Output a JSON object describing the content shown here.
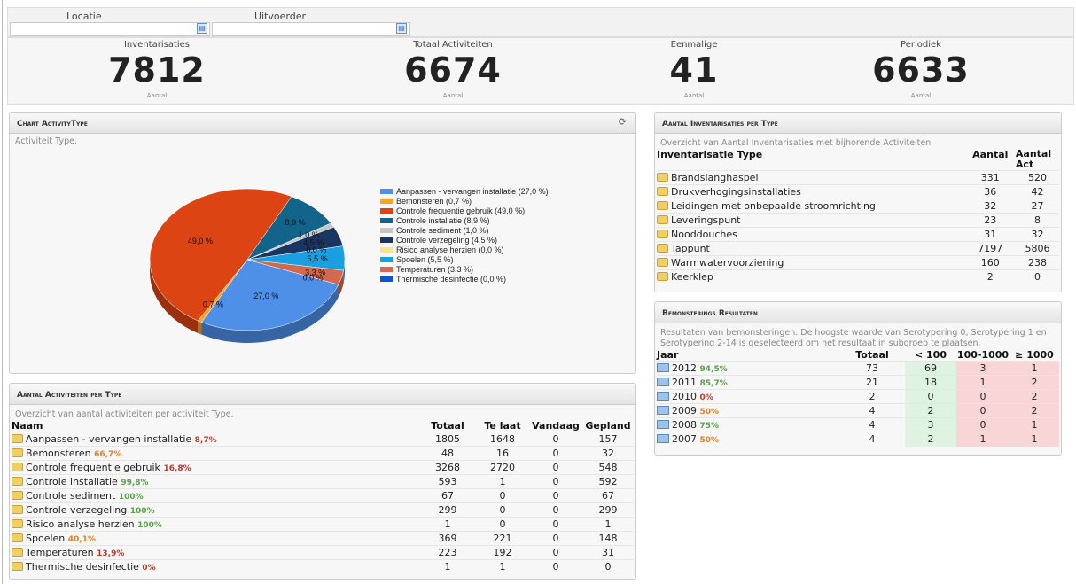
{
  "filters": {
    "locatie_label": "Locatie",
    "uitvoerder_label": "Uitvoerder",
    "locatie_value": "",
    "uitvoerder_value": ""
  },
  "kpis": [
    {
      "title": "Inventarisaties",
      "value": "7812",
      "sub": "Aantal"
    },
    {
      "title": "Totaal Activiteiten",
      "value": "6674",
      "sub": "Aantal"
    },
    {
      "title": "Eenmalige",
      "value": "41",
      "sub": "Aantal"
    },
    {
      "title": "Periodiek",
      "value": "6633",
      "sub": "Aantal"
    }
  ],
  "chart_panel": {
    "title": "Chart ActivityType",
    "subtitle": "Activiteit Type."
  },
  "chart_data": {
    "type": "pie",
    "slices": [
      {
        "label": "Aanpassen - vervangen installatie",
        "legend": "Aanpassen - vervangen installatie (27,0 %)",
        "value": 27.0,
        "label_text": "27,0 %",
        "color": "#4e8fe8"
      },
      {
        "label": "Bemonsteren",
        "legend": "Bemonsteren (0,7 %)",
        "value": 0.7,
        "label_text": "0,7 %",
        "color": "#f5a623"
      },
      {
        "label": "Controle frequentie gebruik",
        "legend": "Controle frequentie gebruik (49,0 %)",
        "value": 49.0,
        "label_text": "49,0 %",
        "color": "#dc4513"
      },
      {
        "label": "Controle installatie",
        "legend": "Controle installatie (8,9 %)",
        "value": 8.9,
        "label_text": "8,9 %",
        "color": "#12648a"
      },
      {
        "label": "Controle sediment",
        "legend": "Controle sediment (1,0 %)",
        "value": 1.0,
        "label_text": "1,0 %",
        "color": "#c6c6c6"
      },
      {
        "label": "Controle verzegeling",
        "legend": "Controle verzegeling (4,5 %)",
        "value": 4.5,
        "label_text": "4,5 %",
        "color": "#1b3561"
      },
      {
        "label": "Risico analyse herzien",
        "legend": "Risico analyse herzien (0,0 %)",
        "value": 0.0,
        "label_text": "0,0 %",
        "color": "#fbe48b"
      },
      {
        "label": "Spoelen",
        "legend": "Spoelen (5,5 %)",
        "value": 5.5,
        "label_text": "5,5 %",
        "color": "#1aa0e0"
      },
      {
        "label": "Temperaturen",
        "legend": "Temperaturen (3,3 %)",
        "value": 3.3,
        "label_text": "3,3 %",
        "color": "#d2694f"
      },
      {
        "label": "Thermische desinfectie",
        "legend": "Thermische desinfectie (0,0 %)",
        "value": 0.0,
        "label_text": "0,0 %",
        "color": "#0b55d5"
      }
    ]
  },
  "activiteiten": {
    "title": "Aantal Activiteiten per Type",
    "desc": "Overzicht van aantal activiteiten per activiteit Type.",
    "headers": [
      "Naam",
      "Totaal",
      "Te laat",
      "Vandaag",
      "Gepland"
    ],
    "rows": [
      {
        "name": "Aanpassen - vervangen installatie",
        "pct": "8,7%",
        "pct_color": "red",
        "totaal": "1805",
        "telaat": "1648",
        "vandaag": "0",
        "gepland": "157"
      },
      {
        "name": "Bemonsteren",
        "pct": "66,7%",
        "pct_color": "orange",
        "totaal": "48",
        "telaat": "16",
        "vandaag": "0",
        "gepland": "32"
      },
      {
        "name": "Controle frequentie gebruik",
        "pct": "16,8%",
        "pct_color": "red",
        "totaal": "3268",
        "telaat": "2720",
        "vandaag": "0",
        "gepland": "548"
      },
      {
        "name": "Controle installatie",
        "pct": "99,8%",
        "pct_color": "green",
        "totaal": "593",
        "telaat": "1",
        "vandaag": "0",
        "gepland": "592"
      },
      {
        "name": "Controle sediment",
        "pct": "100%",
        "pct_color": "green",
        "totaal": "67",
        "telaat": "0",
        "vandaag": "0",
        "gepland": "67"
      },
      {
        "name": "Controle verzegeling",
        "pct": "100%",
        "pct_color": "green",
        "totaal": "299",
        "telaat": "0",
        "vandaag": "0",
        "gepland": "299"
      },
      {
        "name": "Risico analyse herzien",
        "pct": "100%",
        "pct_color": "green",
        "totaal": "1",
        "telaat": "0",
        "vandaag": "0",
        "gepland": "1"
      },
      {
        "name": "Spoelen",
        "pct": "40,1%",
        "pct_color": "orange",
        "totaal": "369",
        "telaat": "221",
        "vandaag": "0",
        "gepland": "148"
      },
      {
        "name": "Temperaturen",
        "pct": "13,9%",
        "pct_color": "red",
        "totaal": "223",
        "telaat": "192",
        "vandaag": "0",
        "gepland": "31"
      },
      {
        "name": "Thermische desinfectie",
        "pct": "0%",
        "pct_color": "red",
        "totaal": "1",
        "telaat": "1",
        "vandaag": "0",
        "gepland": "0"
      }
    ]
  },
  "inventarisaties": {
    "title": "Aantal Inventarisaties per Type",
    "desc": "Overzicht van Aantal Inventarisaties met bijhorende Activiteiten",
    "headers": [
      "Inventarisatie Type",
      "Aantal",
      "Aantal Act"
    ],
    "rows": [
      {
        "name": "Brandslanghaspel",
        "aantal": "331",
        "act": "520"
      },
      {
        "name": "Drukverhogingsinstallaties",
        "aantal": "36",
        "act": "42"
      },
      {
        "name": "Leidingen met onbepaalde stroomrichting",
        "aantal": "32",
        "act": "27"
      },
      {
        "name": "Leveringspunt",
        "aantal": "23",
        "act": "8"
      },
      {
        "name": "Nooddouches",
        "aantal": "31",
        "act": "32"
      },
      {
        "name": "Tappunt",
        "aantal": "7197",
        "act": "5806"
      },
      {
        "name": "Warmwatervoorziening",
        "aantal": "160",
        "act": "238"
      },
      {
        "name": "Keerklep",
        "aantal": "2",
        "act": "0"
      }
    ]
  },
  "bemonstering": {
    "title": "Bemonsterings Resultaten",
    "desc": "Resultaten van bemonsteringen. De hoogste waarde van Serotypering 0, Serotypering 1 en Serotypering 2-14 is geselecteerd om het resultaat in subgroep te plaatsen.",
    "headers": [
      "Jaar",
      "Totaal",
      "< 100",
      "100-1000",
      "≥ 1000"
    ],
    "rows": [
      {
        "jaar": "2012",
        "pct": "94,5%",
        "pct_color": "green",
        "totaal": "73",
        "lt100": "69",
        "mid": "3",
        "gt": "1"
      },
      {
        "jaar": "2011",
        "pct": "85,7%",
        "pct_color": "green",
        "totaal": "21",
        "lt100": "18",
        "mid": "1",
        "gt": "2"
      },
      {
        "jaar": "2010",
        "pct": "0%",
        "pct_color": "red",
        "totaal": "2",
        "lt100": "0",
        "mid": "0",
        "gt": "2"
      },
      {
        "jaar": "2009",
        "pct": "50%",
        "pct_color": "orange",
        "totaal": "4",
        "lt100": "2",
        "mid": "0",
        "gt": "2"
      },
      {
        "jaar": "2008",
        "pct": "75%",
        "pct_color": "green",
        "totaal": "4",
        "lt100": "3",
        "mid": "0",
        "gt": "1"
      },
      {
        "jaar": "2007",
        "pct": "50%",
        "pct_color": "orange",
        "totaal": "4",
        "lt100": "2",
        "mid": "1",
        "gt": "1"
      }
    ]
  }
}
